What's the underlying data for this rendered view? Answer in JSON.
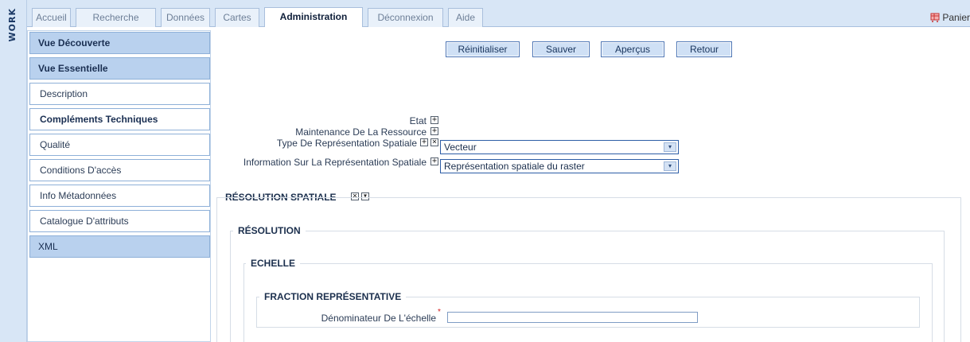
{
  "app": {
    "vertical_label": "WORK"
  },
  "tabs": [
    {
      "label": "Accueil"
    },
    {
      "label": "Recherche"
    },
    {
      "label": "Données"
    },
    {
      "label": "Cartes"
    },
    {
      "label": "Administration",
      "active": true
    },
    {
      "label": "Déconnexion"
    },
    {
      "label": "Aide"
    }
  ],
  "cart": {
    "label": "Panier",
    "icon": "cart-icon"
  },
  "sidebar": {
    "items": [
      {
        "label": "Vue Découverte"
      },
      {
        "label": "Vue Essentielle"
      },
      {
        "label": "Description"
      },
      {
        "label": "Compléments Techniques"
      },
      {
        "label": "Qualité"
      },
      {
        "label": "Conditions D'accès"
      },
      {
        "label": "Info Métadonnées"
      },
      {
        "label": "Catalogue D'attributs"
      },
      {
        "label": "XML"
      }
    ]
  },
  "toolbar": {
    "reset_label": "Réinitialiser",
    "save_label": "Sauver",
    "preview_label": "Aperçus",
    "back_label": "Retour"
  },
  "form": {
    "etat_label": "Etat",
    "maintenance_label": "Maintenance De La Ressource",
    "type_label": "Type De Représentation Spatiale",
    "type_value": "Vecteur",
    "info_label": "Information Sur La Représentation Spatiale",
    "info_value": "Représentation spatiale du raster",
    "plus_glyph": "+",
    "remove_glyph": "×",
    "collapse_glyph": "▾",
    "dropdown_glyph": "▾"
  },
  "sections": {
    "resolution_spatiale": "RÉSOLUTION SPATIALE",
    "resolution": "RÉSOLUTION",
    "echelle": "ECHELLE",
    "fraction": "FRACTION REPRÉSENTATIVE",
    "denominator_label": "Dénominateur De L'échelle",
    "denominator_value": "",
    "required_mark": "*"
  }
}
